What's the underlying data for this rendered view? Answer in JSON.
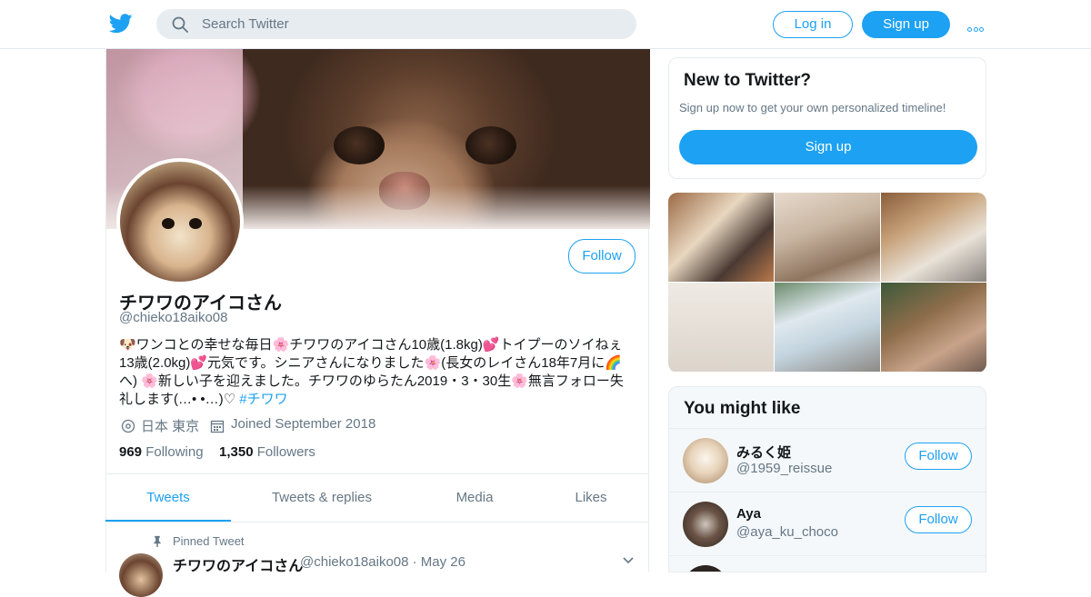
{
  "topbar": {
    "logo_icon": "twitter-bird-icon",
    "search_placeholder": "Search Twitter",
    "login_label": "Log in",
    "signup_label": "Sign up",
    "more_icon": "more-dots-icon"
  },
  "profile": {
    "name": "チワワのアイコさん",
    "handle": "@chieko18aiko08",
    "follow_label": "Follow",
    "bio_lines": [
      "🐶ワンコとの幸せな毎日🌸チワワのアイコさん10歳(1.8kg)💕トイプーのソイねぇ",
      "13歳(2.0kg)💕元気です。シニアさんになりました🌸(長女のレイさん18年7月に🌈",
      "へ) 🌸新しい子を迎えました。チワワのゆらたん2019・3・30生🌸無言フォロー失",
      "礼します(…• •…)♡ "
    ],
    "bio_hashtag": "#チワワ",
    "location": "日本 東京",
    "joined": "Joined September 2018",
    "following_count": "969",
    "following_label": "Following",
    "followers_count": "1,350",
    "followers_label": "Followers"
  },
  "tabs": [
    {
      "label": "Tweets",
      "active": true
    },
    {
      "label": "Tweets & replies",
      "active": false
    },
    {
      "label": "Media",
      "active": false
    },
    {
      "label": "Likes",
      "active": false
    }
  ],
  "pinned": {
    "label": "Pinned Tweet",
    "name": "チワワのアイコさん",
    "meta": "@chieko18aiko08 · May 26"
  },
  "new_to_twitter": {
    "title": "New to Twitter?",
    "subtitle": "Sign up now to get your own personalized timeline!",
    "signup_label": "Sign up"
  },
  "you_might_like": {
    "title": "You might like",
    "accounts": [
      {
        "name": "みるく姫",
        "handle": "@1959_reissue",
        "follow_label": "Follow"
      },
      {
        "name": "Aya",
        "handle": "@aya_ku_choco",
        "follow_label": "Follow"
      }
    ]
  },
  "colors": {
    "accent": "#1da1f2",
    "muted_text": "#657786",
    "border": "#e6ecf0"
  }
}
